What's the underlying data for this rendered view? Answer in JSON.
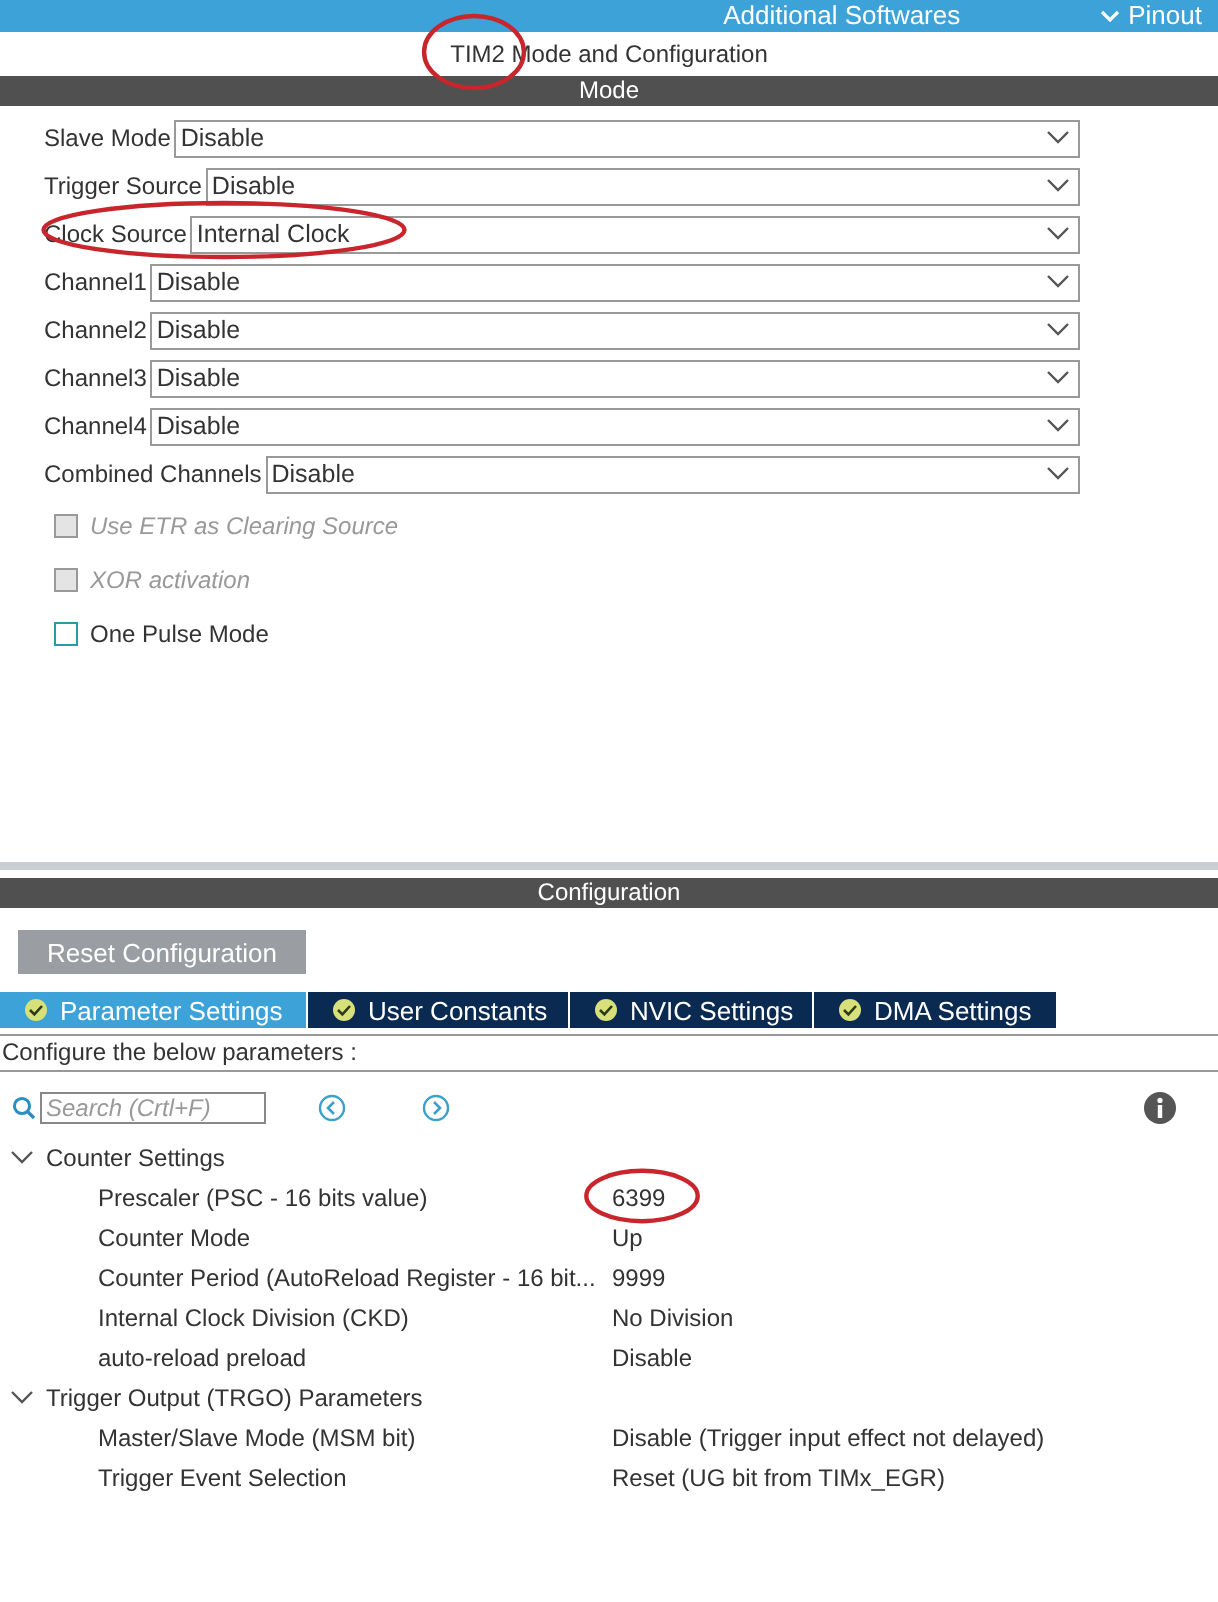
{
  "top_bar": {
    "items": [
      {
        "label": "Additional Softwares"
      },
      {
        "label": "Pinout"
      }
    ]
  },
  "title": {
    "text": "TIM2 Mode and Configuration",
    "annotated": true
  },
  "mode": {
    "header": "Mode",
    "fields": [
      {
        "label": "Slave Mode",
        "value": "Disable",
        "annotated": false
      },
      {
        "label": "Trigger Source",
        "value": "Disable",
        "annotated": false
      },
      {
        "label": "Clock Source",
        "value": "Internal Clock",
        "annotated": true
      },
      {
        "label": "Channel1",
        "value": "Disable",
        "annotated": false
      },
      {
        "label": "Channel2",
        "value": "Disable",
        "annotated": false
      },
      {
        "label": "Channel3",
        "value": "Disable",
        "annotated": false
      },
      {
        "label": "Channel4",
        "value": "Disable",
        "annotated": false
      },
      {
        "label": "Combined Channels",
        "value": "Disable",
        "annotated": false
      }
    ],
    "checkboxes": [
      {
        "label": "Use ETR as Clearing Source",
        "checked": false,
        "disabled": true
      },
      {
        "label": "XOR activation",
        "checked": false,
        "disabled": true
      },
      {
        "label": "One Pulse Mode",
        "checked": false,
        "disabled": false
      }
    ]
  },
  "configuration": {
    "header": "Configuration",
    "reset_button": "Reset Configuration",
    "tabs": [
      {
        "label": "Parameter Settings",
        "selected": true
      },
      {
        "label": "User Constants",
        "selected": false
      },
      {
        "label": "NVIC Settings",
        "selected": false
      },
      {
        "label": "DMA Settings",
        "selected": false
      }
    ],
    "instructions": "Configure the below parameters :",
    "search": {
      "placeholder": "Search (Crtl+F)"
    },
    "tree": [
      {
        "label": "Counter Settings",
        "expanded": true,
        "children": [
          {
            "label": "Prescaler (PSC - 16 bits value)",
            "value": "6399",
            "annotated": true
          },
          {
            "label": "Counter Mode",
            "value": "Up",
            "annotated": false
          },
          {
            "label": "Counter Period (AutoReload Register - 16 bit...",
            "value": "9999",
            "annotated": false
          },
          {
            "label": "Internal Clock Division (CKD)",
            "value": "No Division",
            "annotated": false
          },
          {
            "label": "auto-reload preload",
            "value": "Disable",
            "annotated": false
          }
        ]
      },
      {
        "label": "Trigger Output (TRGO) Parameters",
        "expanded": true,
        "children": [
          {
            "label": "Master/Slave Mode (MSM bit)",
            "value": "Disable (Trigger input effect not delayed)",
            "annotated": false
          },
          {
            "label": "Trigger Event Selection",
            "value": "Reset (UG bit from TIMx_EGR)",
            "annotated": false
          }
        ]
      }
    ]
  }
}
